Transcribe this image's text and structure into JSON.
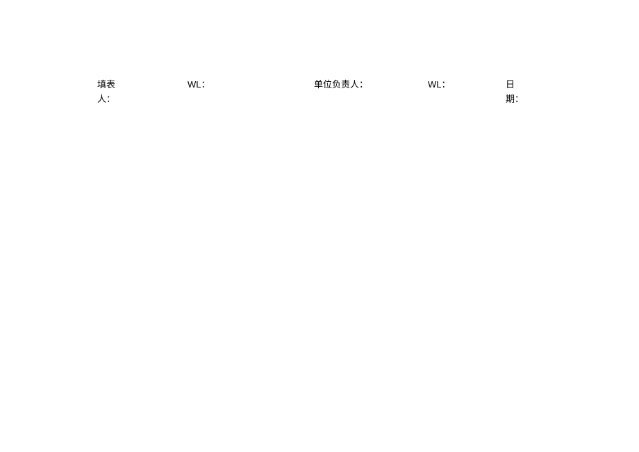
{
  "signature": {
    "preparer_label": "填表人：",
    "wl1_label": "WL：",
    "responsible_label": "单位负责人：",
    "wl2_label": "WL：",
    "date_label": "日期："
  }
}
